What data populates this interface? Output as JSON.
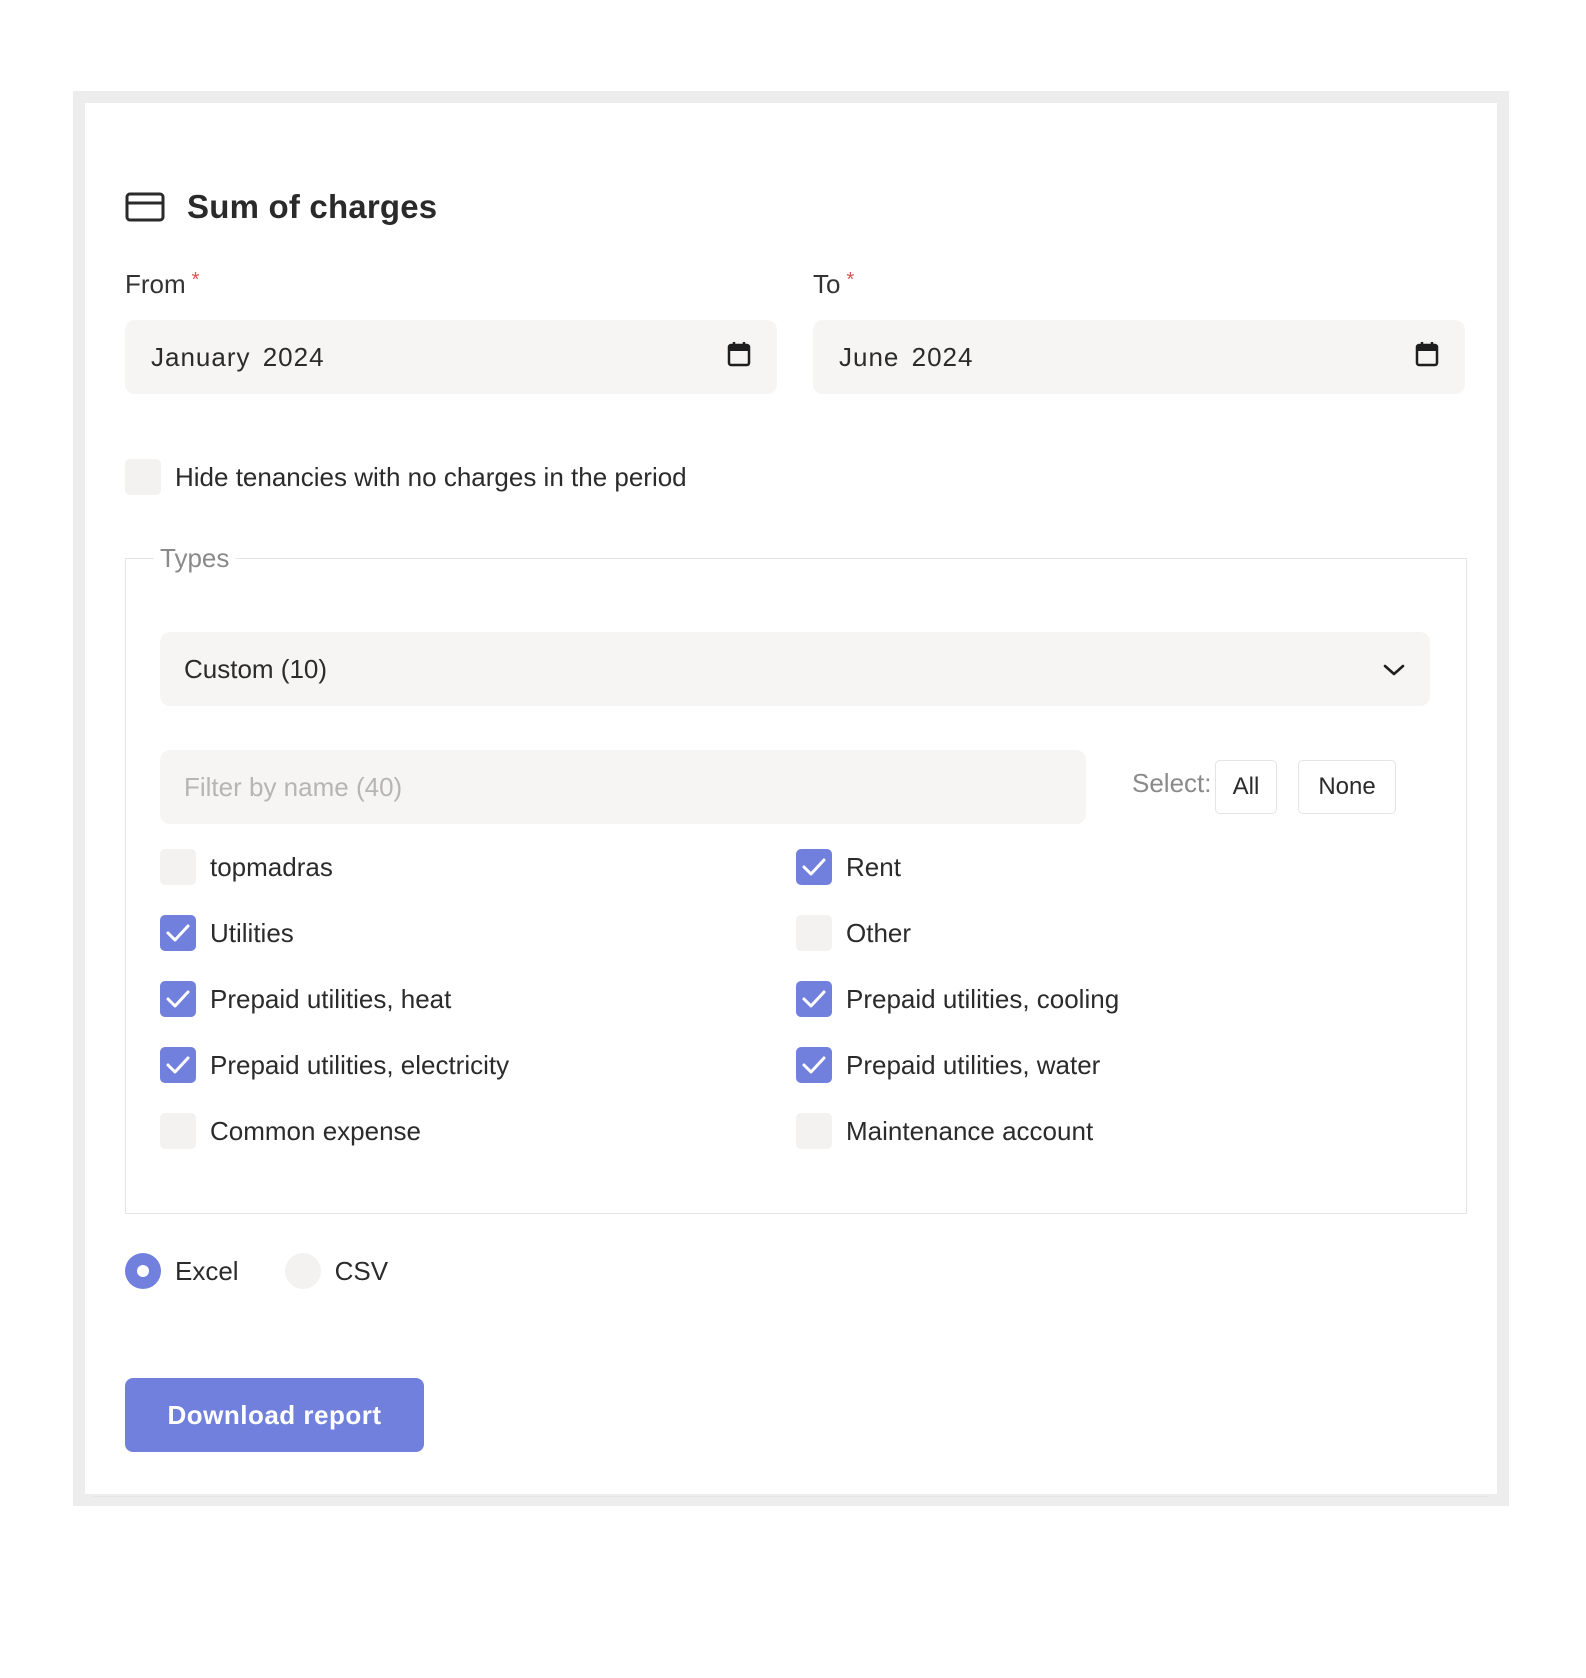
{
  "report": {
    "title": "Sum of charges",
    "title_icon": "credit-card-icon"
  },
  "period": {
    "from_label": "From",
    "to_label": "To",
    "required_mark": "*",
    "from_value": "January 2024",
    "to_value": "June 2024",
    "calendar_icon": "calendar-icon"
  },
  "hide_empty": {
    "label": "Hide tenancies with no charges in the period",
    "checked": false
  },
  "types": {
    "legend": "Types",
    "selected_preset": "Custom (10)",
    "filter_placeholder": "Filter by name (40)",
    "select_label": "Select:",
    "all_label": "All",
    "none_label": "None",
    "options": [
      {
        "label": "topmadras",
        "checked": false
      },
      {
        "label": "Rent",
        "checked": true
      },
      {
        "label": "Utilities",
        "checked": true
      },
      {
        "label": "Other",
        "checked": false
      },
      {
        "label": "Prepaid utilities, heat",
        "checked": true
      },
      {
        "label": "Prepaid utilities, cooling",
        "checked": true
      },
      {
        "label": "Prepaid utilities, electricity",
        "checked": true
      },
      {
        "label": "Prepaid utilities, water",
        "checked": true
      },
      {
        "label": "Common expense",
        "checked": false
      },
      {
        "label": "Maintenance account",
        "checked": false
      }
    ]
  },
  "format": {
    "excel_label": "Excel",
    "csv_label": "CSV",
    "selected": "Excel"
  },
  "actions": {
    "download_label": "Download report"
  },
  "colors": {
    "accent": "#7280dd",
    "required": "#d9534f",
    "field_bg": "#f6f5f4"
  }
}
